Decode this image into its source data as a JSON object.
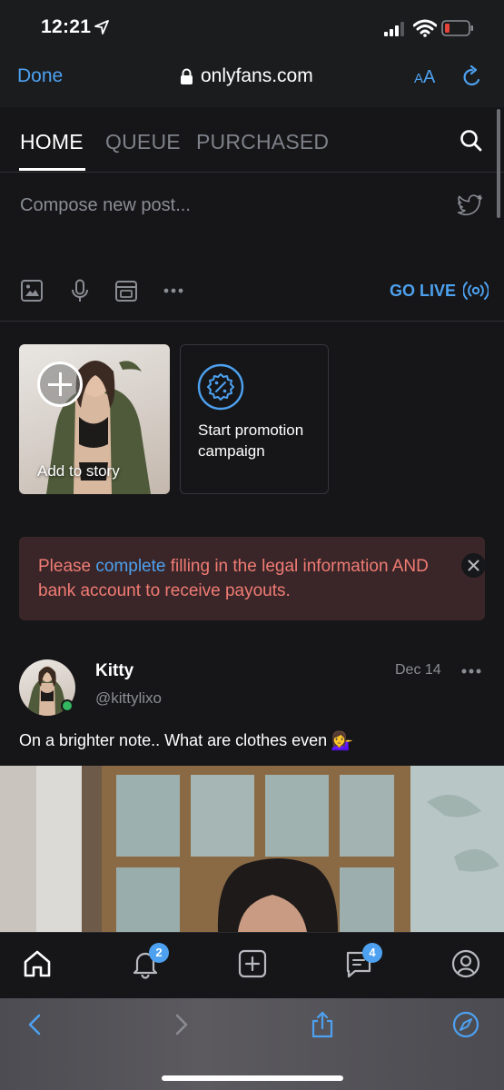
{
  "status_bar": {
    "time": "12:21"
  },
  "browser": {
    "done_label": "Done",
    "url": "onlyfans.com",
    "text_size_big": "A",
    "text_size_small": "A"
  },
  "tabs": [
    {
      "label": "HOME"
    },
    {
      "label": "QUEUE"
    },
    {
      "label": "PURCHASED"
    }
  ],
  "compose": {
    "placeholder": "Compose new post...",
    "go_live_label": "GO LIVE"
  },
  "stories": {
    "add_label": "Add to story",
    "promo_label": "Start promotion campaign"
  },
  "alert": {
    "text_before": "Please ",
    "link_text": "complete",
    "text_after": " filling in the legal information AND bank account to receive payouts."
  },
  "post": {
    "author_name": "Kitty",
    "author_handle": "@kittylixo",
    "date": "Dec 14",
    "caption": "On a brighter note.. What are clothes even",
    "caption_emoji": "💁‍♀️"
  },
  "bottom_nav": {
    "notifications_badge": "2",
    "messages_badge": "4"
  },
  "colors": {
    "accent": "#4da1f0",
    "alert_text": "#f07b74",
    "alert_bg": "#3a2628",
    "online": "#33b760",
    "background": "#161618"
  }
}
